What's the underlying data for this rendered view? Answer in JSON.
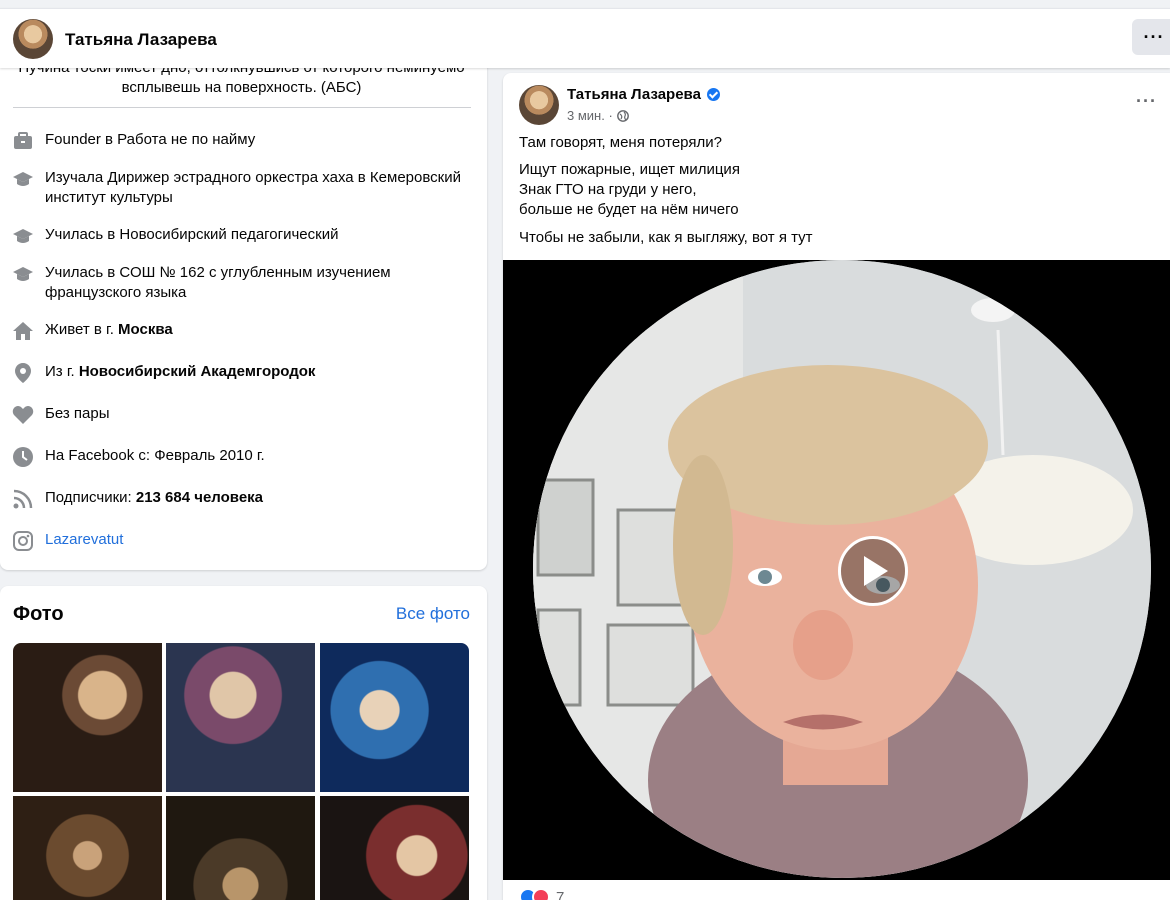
{
  "header": {
    "name": "Татьяна Лазарева",
    "more_icon": "ellipsis-icon"
  },
  "intro": {
    "bio": "Пучина тоски имеет дно, оттолкнувшись от которого неминуемо всплывешь на поверхность. (АБС)",
    "work": "Founder в Работа не по найму",
    "education_1": "Изучала Дирижер эстрадного оркестра хаха в Кемеровский институт культуры",
    "education_2": "Училась в Новосибирский педагогический",
    "education_3": "Училась в СОШ № 162 с углубленным изучением французского языка",
    "lives_prefix": "Живет в г. ",
    "lives_city": "Москва",
    "from_prefix": "Из г. ",
    "from_city": "Новосибирский Академгородок",
    "relationship": "Без пары",
    "joined": "На Facebook с: Февраль 2010 г.",
    "followers_prefix": "Подписчики: ",
    "followers_count": "213 684 человека",
    "instagram": "Lazarevatut"
  },
  "photos": {
    "title": "Фото",
    "see_all": "Все фото"
  },
  "post": {
    "author": "Татьяна Лазарева",
    "time": "3 мин. ·",
    "line_1": "Там говорят, меня потеряли?",
    "line_2": "Ищут пожарные, ищет милиция",
    "line_3": "Знак ГТО на груди у него,",
    "line_4": "больше не будет на нём ничего",
    "line_5": "Чтобы не забыли, как я выгляжу, вот я тут",
    "reaction_count": "7"
  },
  "colors": {
    "link": "#216fdb",
    "accent": "#1877f2",
    "background": "#f0f2f5"
  }
}
